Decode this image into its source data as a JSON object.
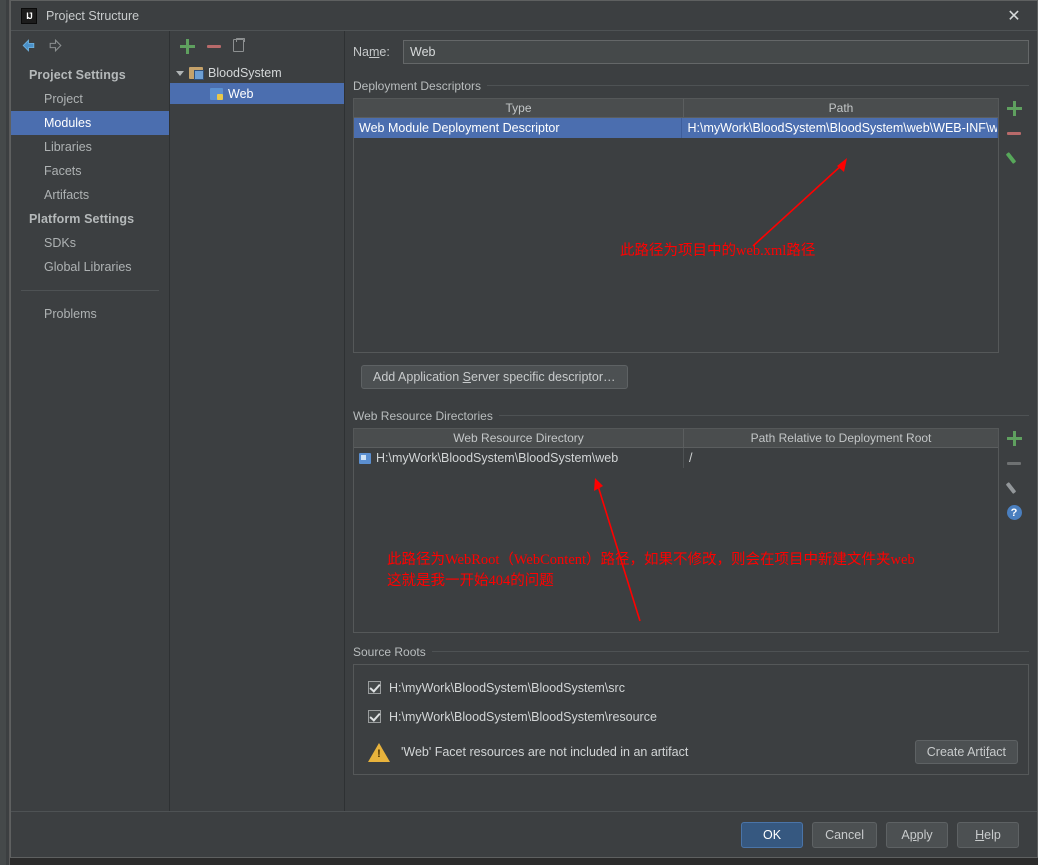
{
  "window": {
    "title": "Project Structure",
    "icon": "intellij-idea-icon",
    "close_label": "✕"
  },
  "nav": {
    "back_icon": "back-arrow-icon",
    "forward_icon": "forward-arrow-icon"
  },
  "sidebar": {
    "groups": [
      {
        "label": "Project Settings",
        "items": [
          {
            "label": "Project",
            "selected": false
          },
          {
            "label": "Modules",
            "selected": true
          },
          {
            "label": "Libraries",
            "selected": false
          },
          {
            "label": "Facets",
            "selected": false
          },
          {
            "label": "Artifacts",
            "selected": false
          }
        ]
      },
      {
        "label": "Platform Settings",
        "items": [
          {
            "label": "SDKs",
            "selected": false
          },
          {
            "label": "Global Libraries",
            "selected": false
          }
        ]
      }
    ],
    "problems_label": "Problems"
  },
  "tree": {
    "toolbar": [
      {
        "name": "add-module-button",
        "icon": "plus-icon"
      },
      {
        "name": "remove-module-button",
        "icon": "minus-icon"
      },
      {
        "name": "copy-module-button",
        "icon": "copy-icon"
      }
    ],
    "nodes": [
      {
        "label": "BloodSystem",
        "icon": "module-folder-icon",
        "expanded": true,
        "selected": false,
        "level": 0
      },
      {
        "label": "Web",
        "icon": "web-facet-icon",
        "expanded": false,
        "selected": true,
        "level": 1
      }
    ]
  },
  "form": {
    "name_label_before": "Na",
    "name_label_mnemonic": "m",
    "name_label_after": "e:",
    "name_value": "Web",
    "name_placeholder": ""
  },
  "deployment_descriptors": {
    "title": "Deployment Descriptors",
    "columns": [
      "Type",
      "Path"
    ],
    "rows": [
      {
        "type": "Web Module Deployment Descriptor",
        "path": "H:\\myWork\\BloodSystem\\BloodSystem\\web\\WEB-INF\\w",
        "selected": true
      }
    ],
    "tools": [
      {
        "name": "add-descriptor-button",
        "icon": "plus-icon"
      },
      {
        "name": "remove-descriptor-button",
        "icon": "minus-icon"
      },
      {
        "name": "edit-descriptor-button",
        "icon": "pencil-icon"
      }
    ],
    "add_button": {
      "before": "Add Application ",
      "mnemonic": "S",
      "after": "erver specific descriptor…"
    }
  },
  "web_resource_directories": {
    "title": "Web Resource Directories",
    "columns": [
      "Web Resource Directory",
      "Path Relative to Deployment Root"
    ],
    "rows": [
      {
        "directory": "H:\\myWork\\BloodSystem\\BloodSystem\\web",
        "relative_path": "/",
        "icon": "directory-icon"
      }
    ],
    "tools": [
      {
        "name": "add-web-resource-button",
        "icon": "plus-icon"
      },
      {
        "name": "remove-web-resource-button",
        "icon": "minus-icon"
      },
      {
        "name": "edit-web-resource-button",
        "icon": "pencil-icon"
      },
      {
        "name": "web-resource-help-button",
        "icon": "help-icon",
        "glyph": "?"
      }
    ]
  },
  "source_roots": {
    "title": "Source Roots",
    "rows": [
      {
        "path": "H:\\myWork\\BloodSystem\\BloodSystem\\src",
        "checked": true
      },
      {
        "path": "H:\\myWork\\BloodSystem\\BloodSystem\\resource",
        "checked": true
      }
    ],
    "warning": {
      "icon": "warning-triangle-icon",
      "text": "'Web' Facet resources are not included in an artifact",
      "action_before": "Create Arti",
      "action_mnemonic": "f",
      "action_after": "act"
    }
  },
  "footer": {
    "buttons": [
      {
        "label": "OK",
        "primary": true,
        "name": "ok-button"
      },
      {
        "label": "Cancel",
        "primary": false,
        "name": "cancel-button"
      },
      {
        "label": "Apply",
        "primary": false,
        "name": "apply-button",
        "mnemonic_index": 1
      },
      {
        "label": "Help",
        "primary": false,
        "name": "help-button",
        "mnemonic_index": 0
      }
    ]
  },
  "annotations": [
    {
      "id": "descriptor-note",
      "text": "此路径为项目中的web.xml路径",
      "color": "#ff0000"
    },
    {
      "id": "webroot-note-line1",
      "text": "此路径为WebRoot（WebContent）路径，如果不修改，则会在项目中新建文件夹web",
      "color": "#ff0000"
    },
    {
      "id": "webroot-note-line2",
      "text": "这就是我一开始404的问题",
      "color": "#ff0000"
    }
  ],
  "colors": {
    "accent_selection": "#4b6eaf",
    "panel_bg": "#3c3f41",
    "input_bg": "#45494a",
    "annotation": "#ff0000",
    "warning": "#e8b33c",
    "add_icon": "#5fa05f",
    "remove_icon": "#b86a6a"
  }
}
